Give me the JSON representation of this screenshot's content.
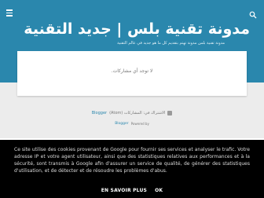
{
  "blog": {
    "title": "مدونة تقنية بلس | جديد التقنية",
    "subtitle": "مدونة تقنية بلس مدونة تهتم بتقديم كل ما هو جديد في عالم التقنية"
  },
  "main": {
    "empty_message": "لا توجد أي مشاركات."
  },
  "footer": {
    "feed_label": "Blogger",
    "feed_text": "الاشتراك في: المشاركات (Atom)",
    "powered_by": "Powered by",
    "blogger_logo_text": "Blogger"
  },
  "cookie_notice": {
    "text": "Ce site utilise des cookies provenant de Google pour fournir ses services et analyser le trafic. Votre adresse IP et votre agent utilisateur, ainsi que des statistiques relatives aux performances et à la sécurité, sont transmis à Google afin d'assurer un service de qualité, de générer des statistiques d'utilisation, et de détecter et de résoudre les problèmes d'abus.",
    "learn_more_label": "EN SAVOIR PLUS",
    "ok_label": "OK"
  },
  "colors": {
    "header_bg": "#2a87ad",
    "page_bg": "#ececec",
    "cookie_bg": "#000000"
  },
  "icons": {
    "menu": "menu-icon",
    "search": "search-icon",
    "feed": "feed-icon"
  }
}
